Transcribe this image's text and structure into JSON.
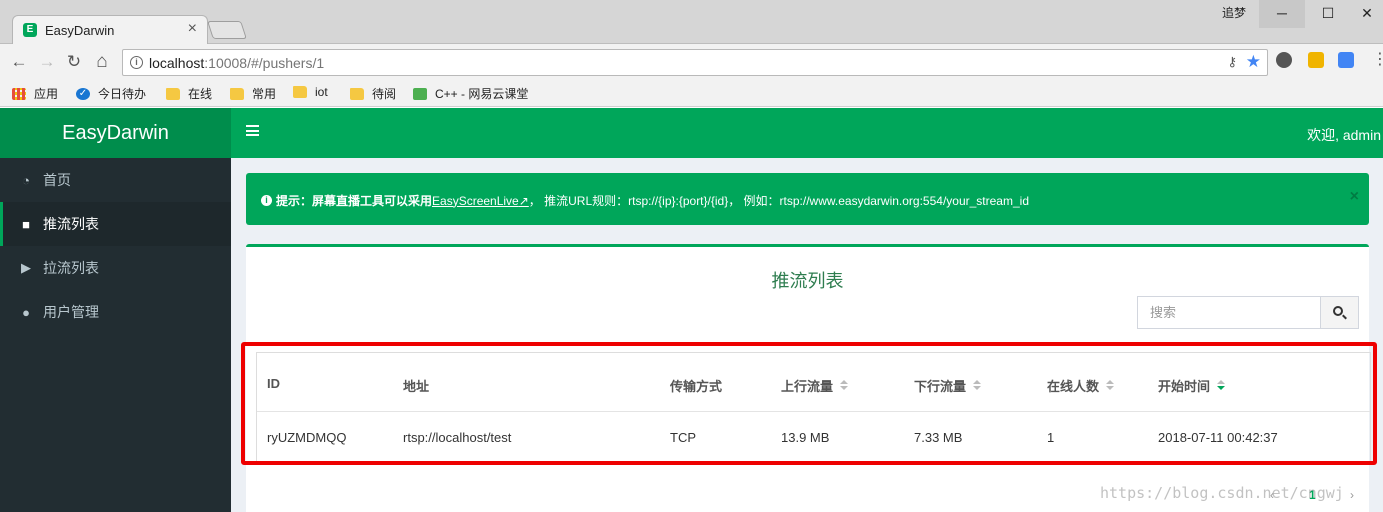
{
  "browser": {
    "tab_title": "EasyDarwin",
    "tab_favicon": "E",
    "tab_close": "×",
    "window_user": "追梦",
    "win_min": "─",
    "win_max": "☐",
    "win_close": "✕",
    "back": "←",
    "forward": "→",
    "reload": "↻",
    "home": "⌂",
    "url_host": "localhost",
    "url_rest": ":10008/#/pushers/1",
    "info": "i",
    "key": "⚷",
    "star": "★",
    "menu": "⋮",
    "bookmarks": [
      {
        "label": "应用"
      },
      {
        "label": "今日待办"
      },
      {
        "label": "在线"
      },
      {
        "label": "常用"
      },
      {
        "label": "iot"
      },
      {
        "label": "待阅"
      },
      {
        "label": "C++ - 网易云课堂"
      }
    ]
  },
  "app": {
    "logo": "EasyDarwin",
    "welcome": "欢迎, admin",
    "sidebar": {
      "items": [
        {
          "label": "首页",
          "icon": "dashboard-icon",
          "glyph": "◔"
        },
        {
          "label": "推流列表",
          "icon": "video-camera-icon",
          "glyph": "■"
        },
        {
          "label": "拉流列表",
          "icon": "play-icon",
          "glyph": "▶"
        },
        {
          "label": "用户管理",
          "icon": "users-icon",
          "glyph": "●"
        }
      ]
    },
    "alert": {
      "prefix": "提示：屏幕直播工具可以采用",
      "link": "EasyScreenLive",
      "link_icon": "↗",
      "rule": "，  推流URL规则：rtsp://{ip}:{port}/{id}，  例如：rtsp://www.easydarwin.org:554/your_stream_id",
      "info": "i",
      "close": "×"
    },
    "box": {
      "title": "推流列表",
      "search_placeholder": "搜索"
    },
    "table": {
      "headers": [
        "ID",
        "地址",
        "传输方式",
        "上行流量",
        "下行流量",
        "在线人数",
        "开始时间"
      ],
      "rows": [
        [
          "ryUZMDMQQ",
          "rtsp://localhost/test",
          "TCP",
          "13.9 MB",
          "7.33 MB",
          "1",
          "2018-07-11 00:42:37"
        ]
      ]
    },
    "pager": {
      "prev": "‹",
      "current": "1",
      "next": "›"
    },
    "watermark": "https://blog.csdn.net/cngwj"
  },
  "colors": {
    "accent": "#00a65a",
    "accent_dark": "#008d4c",
    "sidebar_bg": "#222d32",
    "highlight": "#ee0000"
  }
}
